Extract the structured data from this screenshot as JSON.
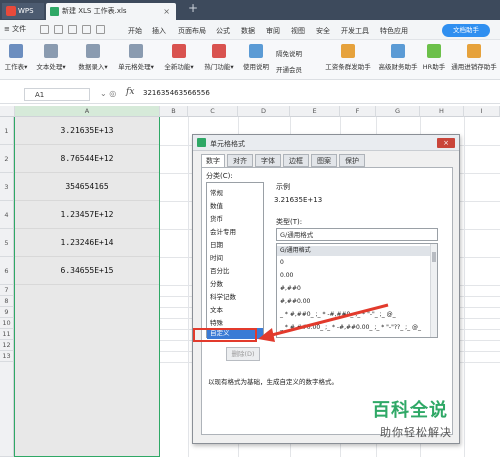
{
  "titlebar": {
    "app_tab": "WPS",
    "doc_tab": "新建 XLS 工作表.xls",
    "close_glyph": "×",
    "add_glyph": "+"
  },
  "menubar": {
    "file": "≡ 文件",
    "items": [
      "开始",
      "插入",
      "页面布局",
      "公式",
      "数据",
      "审阅",
      "视图",
      "安全",
      "开发工具",
      "特色应用"
    ],
    "assistant": "文档助手"
  },
  "toolbar": {
    "buttons": [
      "工作表▾",
      "文本处理▾",
      "数据录入▾",
      "单元格处理▾",
      "全新功能▾",
      "热门功能▾",
      "使用说明",
      "工资条群发助手",
      "高级财务助手",
      "HR助手",
      "通用进销存助手"
    ],
    "side_items": [
      "隔免说明",
      "开通会员"
    ]
  },
  "formula": {
    "cell_ref": "A1",
    "fx": "fx",
    "value": "321635463566556",
    "icons": "⌄  ◎"
  },
  "grid": {
    "columns": [
      "A",
      "B",
      "C",
      "D",
      "E",
      "F",
      "G",
      "H",
      "I"
    ],
    "rows": [
      "1",
      "2",
      "3",
      "4",
      "5",
      "6",
      "7",
      "8",
      "9",
      "10",
      "11",
      "12",
      "13"
    ],
    "cells": [
      "3.21635E+13",
      "8.76544E+12",
      "354654165",
      "1.23457E+12",
      "1.23246E+14",
      "6.34655E+15"
    ]
  },
  "dialog": {
    "title": "单元格格式",
    "close_glyph": "×",
    "tabs": [
      "数字",
      "对齐",
      "字体",
      "边框",
      "图案",
      "保护"
    ],
    "category_label": "分类(C):",
    "categories": [
      "常规",
      "数值",
      "货币",
      "会计专用",
      "日期",
      "时间",
      "百分比",
      "分数",
      "科学记数",
      "文本",
      "特殊",
      "自定义"
    ],
    "selected_category": "自定义",
    "sample_label": "示例",
    "sample_value": "3.21635E+13",
    "type_label": "类型(T):",
    "type_value": "G/通用格式",
    "types": [
      "G/通用格式",
      "0",
      "0.00",
      "#,##0",
      "#,##0.00",
      "_ * #,##0_ ;_ * -#,##0_ ;_ * \"-\"_ ;_ @_",
      "_ * #,##0.00_ ;_ * -#,##0.00_ ;_ * \"-\"??_ ;_ @_"
    ],
    "delete_label": "删除(D)",
    "description": "以现有格式为基础，生成自定义的数字格式。"
  },
  "watermark": {
    "top": "百科全说",
    "bottom": "助你轻松解决"
  },
  "colors": {
    "accent_green": "#2fa866",
    "highlight_red": "#e23a2c",
    "select_blue": "#3a7bd5"
  }
}
